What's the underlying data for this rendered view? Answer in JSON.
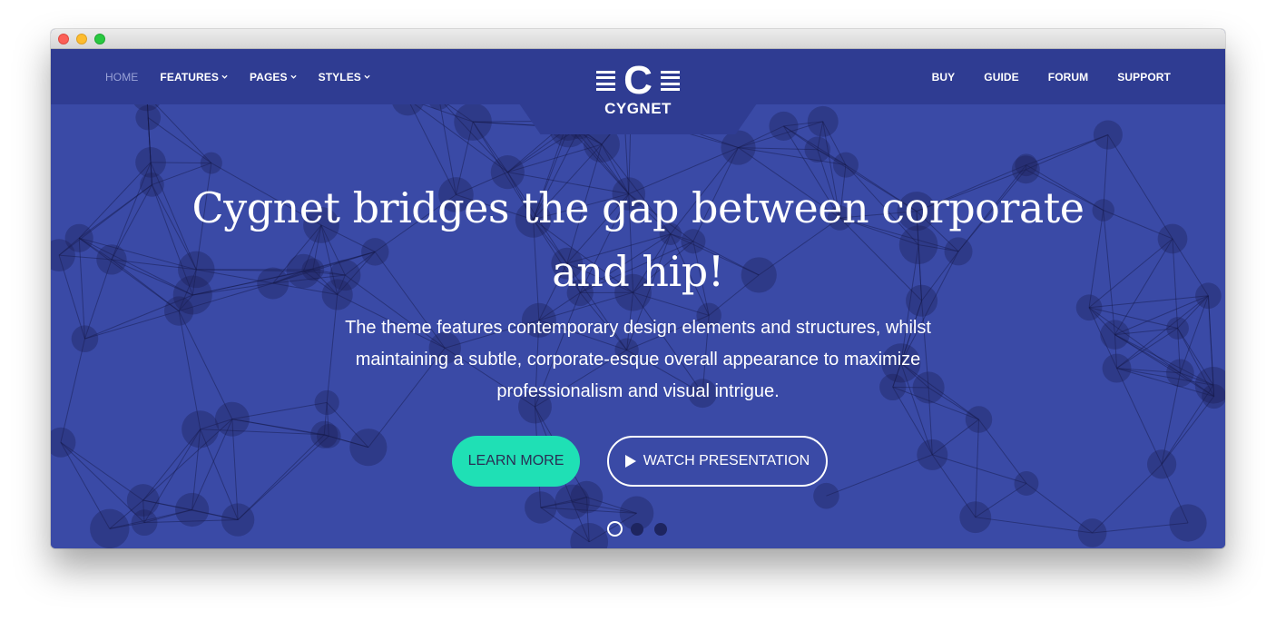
{
  "nav": {
    "left": [
      {
        "label": "HOME",
        "active": true,
        "dropdown": false
      },
      {
        "label": "FEATURES",
        "active": false,
        "dropdown": true
      },
      {
        "label": "PAGES",
        "active": false,
        "dropdown": true
      },
      {
        "label": "STYLES",
        "active": false,
        "dropdown": true
      }
    ],
    "right": [
      {
        "label": "BUY"
      },
      {
        "label": "GUIDE"
      },
      {
        "label": "FORUM"
      },
      {
        "label": "SUPPORT"
      }
    ]
  },
  "logo": {
    "mark": "C",
    "text": "CYGNET"
  },
  "hero": {
    "headline": "Cygnet bridges the gap between corporate and hip!",
    "subtext": "The theme features contemporary design elements and structures, whilst maintaining a subtle, corporate-esque overall appearance to maximize professionalism and visual intrigue.",
    "primary_button": "LEARN MORE",
    "secondary_button": "WATCH PRESENTATION",
    "slide_count": 3,
    "active_slide": 1
  },
  "colors": {
    "hero_background": "#3a4aa6",
    "navbar_background": "#2f3c92",
    "accent": "#1fe0b5",
    "inactive_nav": "#9aa3d8"
  },
  "icons": {
    "secondary_button": "play-icon",
    "nav_dropdown": "chevron-down-icon"
  }
}
